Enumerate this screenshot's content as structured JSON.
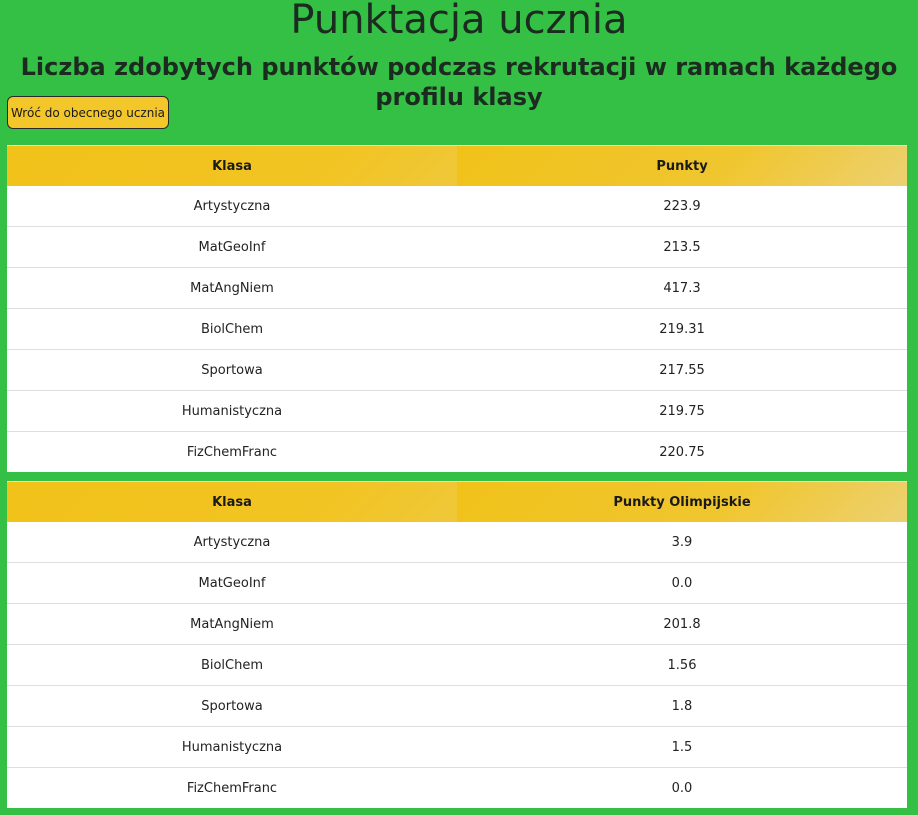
{
  "header": {
    "title": "Punktacja ucznia",
    "subtitle": "Liczba zdobytych punktów podczas rekrutacji w ramach każdego profilu klasy"
  },
  "back_button": {
    "label": "Wróć do obecnego ucznia"
  },
  "points_table": {
    "columns": [
      "Klasa",
      "Punkty"
    ],
    "rows": [
      {
        "class": "Artystyczna",
        "value": "223.9"
      },
      {
        "class": "MatGeoInf",
        "value": "213.5"
      },
      {
        "class": "MatAngNiem",
        "value": "417.3"
      },
      {
        "class": "BiolChem",
        "value": "219.31"
      },
      {
        "class": "Sportowa",
        "value": "217.55"
      },
      {
        "class": "Humanistyczna",
        "value": "219.75"
      },
      {
        "class": "FizChemFranc",
        "value": "220.75"
      }
    ]
  },
  "olympic_table": {
    "columns": [
      "Klasa",
      "Punkty Olimpijskie"
    ],
    "rows": [
      {
        "class": "Artystyczna",
        "value": "3.9"
      },
      {
        "class": "MatGeoInf",
        "value": "0.0"
      },
      {
        "class": "MatAngNiem",
        "value": "201.8"
      },
      {
        "class": "BiolChem",
        "value": "1.56"
      },
      {
        "class": "Sportowa",
        "value": "1.8"
      },
      {
        "class": "Humanistyczna",
        "value": "1.5"
      },
      {
        "class": "FizChemFranc",
        "value": "0.0"
      }
    ]
  },
  "colors": {
    "background": "#33c045",
    "header_gold": "#f1c219",
    "button": "#f3c629"
  }
}
